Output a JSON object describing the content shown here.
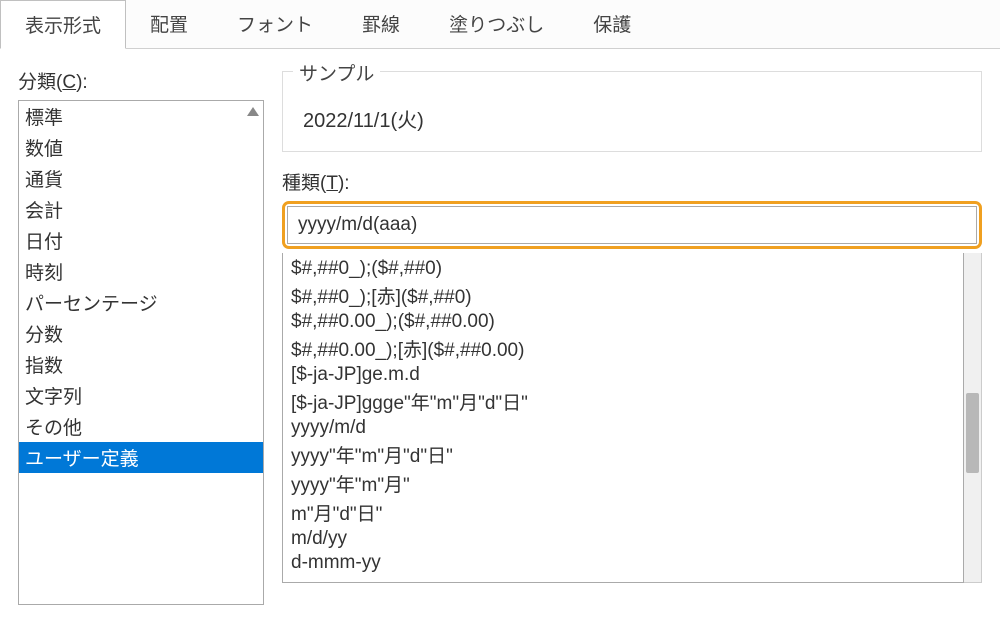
{
  "tabs": [
    {
      "label": "表示形式",
      "active": true
    },
    {
      "label": "配置",
      "active": false
    },
    {
      "label": "フォント",
      "active": false
    },
    {
      "label": "罫線",
      "active": false
    },
    {
      "label": "塗りつぶし",
      "active": false
    },
    {
      "label": "保護",
      "active": false
    }
  ],
  "category": {
    "label_prefix": "分類(",
    "label_key": "C",
    "label_suffix": "):",
    "items": [
      {
        "label": "標準",
        "selected": false
      },
      {
        "label": "数値",
        "selected": false
      },
      {
        "label": "通貨",
        "selected": false
      },
      {
        "label": "会計",
        "selected": false
      },
      {
        "label": "日付",
        "selected": false
      },
      {
        "label": "時刻",
        "selected": false
      },
      {
        "label": "パーセンテージ",
        "selected": false
      },
      {
        "label": "分数",
        "selected": false
      },
      {
        "label": "指数",
        "selected": false
      },
      {
        "label": "文字列",
        "selected": false
      },
      {
        "label": "その他",
        "selected": false
      },
      {
        "label": "ユーザー定義",
        "selected": true
      }
    ]
  },
  "sample": {
    "legend": "サンプル",
    "value": "2022/11/1(火)"
  },
  "type": {
    "label_prefix": "種類(",
    "label_key": "T",
    "label_suffix": "):",
    "value": "yyyy/m/d(aaa)"
  },
  "formats": [
    "$#,##0_);($#,##0)",
    "$#,##0_);[赤]($#,##0)",
    "$#,##0.00_);($#,##0.00)",
    "$#,##0.00_);[赤]($#,##0.00)",
    "[$-ja-JP]ge.m.d",
    "[$-ja-JP]ggge\"年\"m\"月\"d\"日\"",
    "yyyy/m/d",
    "yyyy\"年\"m\"月\"d\"日\"",
    "yyyy\"年\"m\"月\"",
    "m\"月\"d\"日\"",
    "m/d/yy",
    "d-mmm-yy"
  ]
}
